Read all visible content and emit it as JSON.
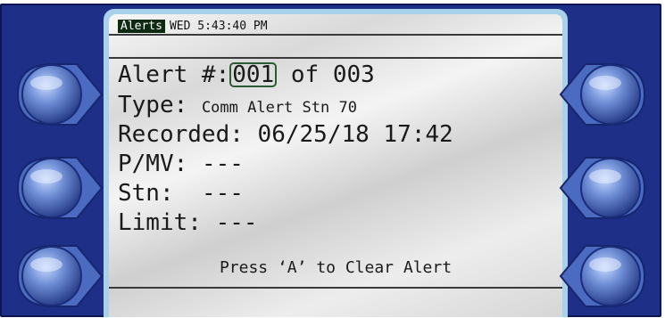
{
  "header": {
    "tab": "Alerts",
    "datetime": "WED 5:43:40 PM"
  },
  "alert": {
    "number_label": "Alert #:",
    "current": "001",
    "of_label": "of",
    "total": "003",
    "type_label": "Type:",
    "type_value": "Comm Alert Stn 70",
    "recorded_label": "Recorded:",
    "recorded_value": "06/25/18 17:42",
    "pmv_label": "P/MV:",
    "pmv_value": "---",
    "stn_label": "Stn:",
    "stn_value": "---",
    "limit_label": "Limit:",
    "limit_value": "---"
  },
  "footer": {
    "instruction": "Press ‘A’ to Clear Alert"
  },
  "softkeys": {
    "left": [
      "left-softkey-1",
      "left-softkey-2",
      "left-softkey-3"
    ],
    "right": [
      "right-softkey-1",
      "right-softkey-2",
      "right-softkey-3"
    ]
  },
  "colors": {
    "bezel": "#1d2f86",
    "rim": "#a9d2ea",
    "tab_bg": "#0f2a12",
    "button": "#5b7fc8"
  }
}
